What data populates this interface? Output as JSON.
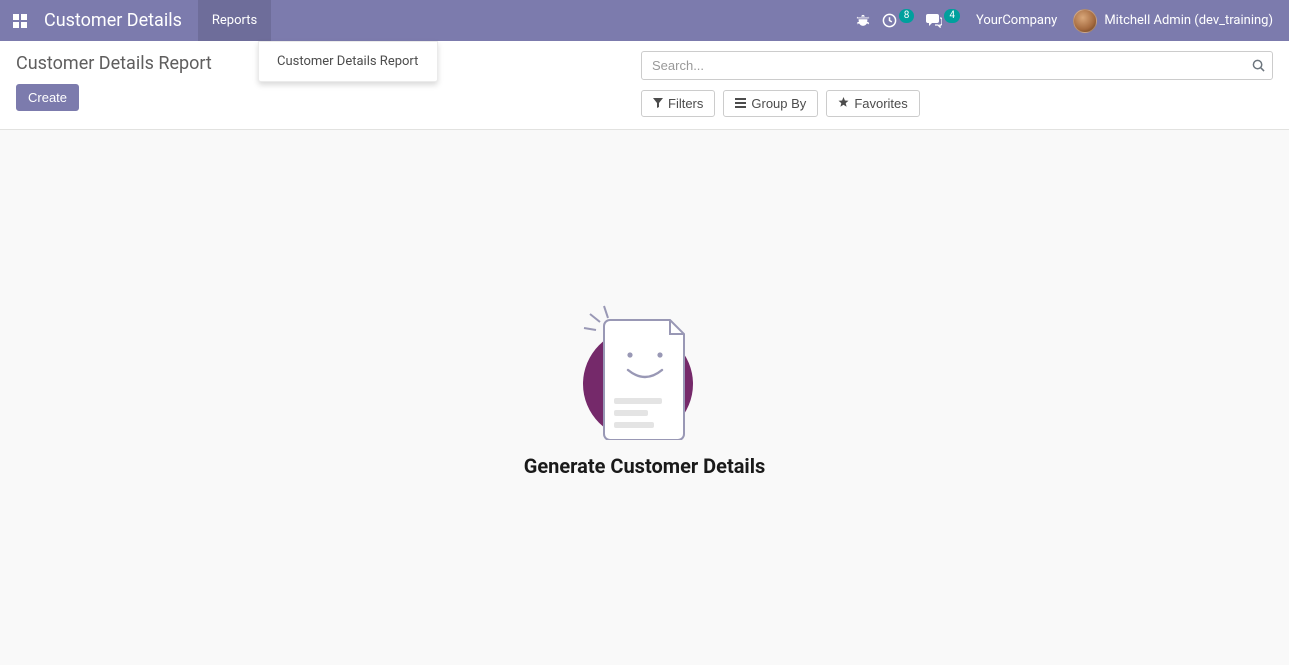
{
  "navbar": {
    "app_title": "Customer Details",
    "menu": {
      "reports": "Reports"
    },
    "badges": {
      "activities": "8",
      "messages": "4"
    },
    "company": "YourCompany",
    "user": "Mitchell Admin (dev_training)"
  },
  "dropdown": {
    "customer_details_report": "Customer Details Report"
  },
  "control_panel": {
    "breadcrumb": "Customer Details Report",
    "create": "Create",
    "search_placeholder": "Search...",
    "filters": " Filters",
    "group_by": " Group By",
    "favorites": " Favorites"
  },
  "empty": {
    "title": "Generate Customer Details"
  }
}
